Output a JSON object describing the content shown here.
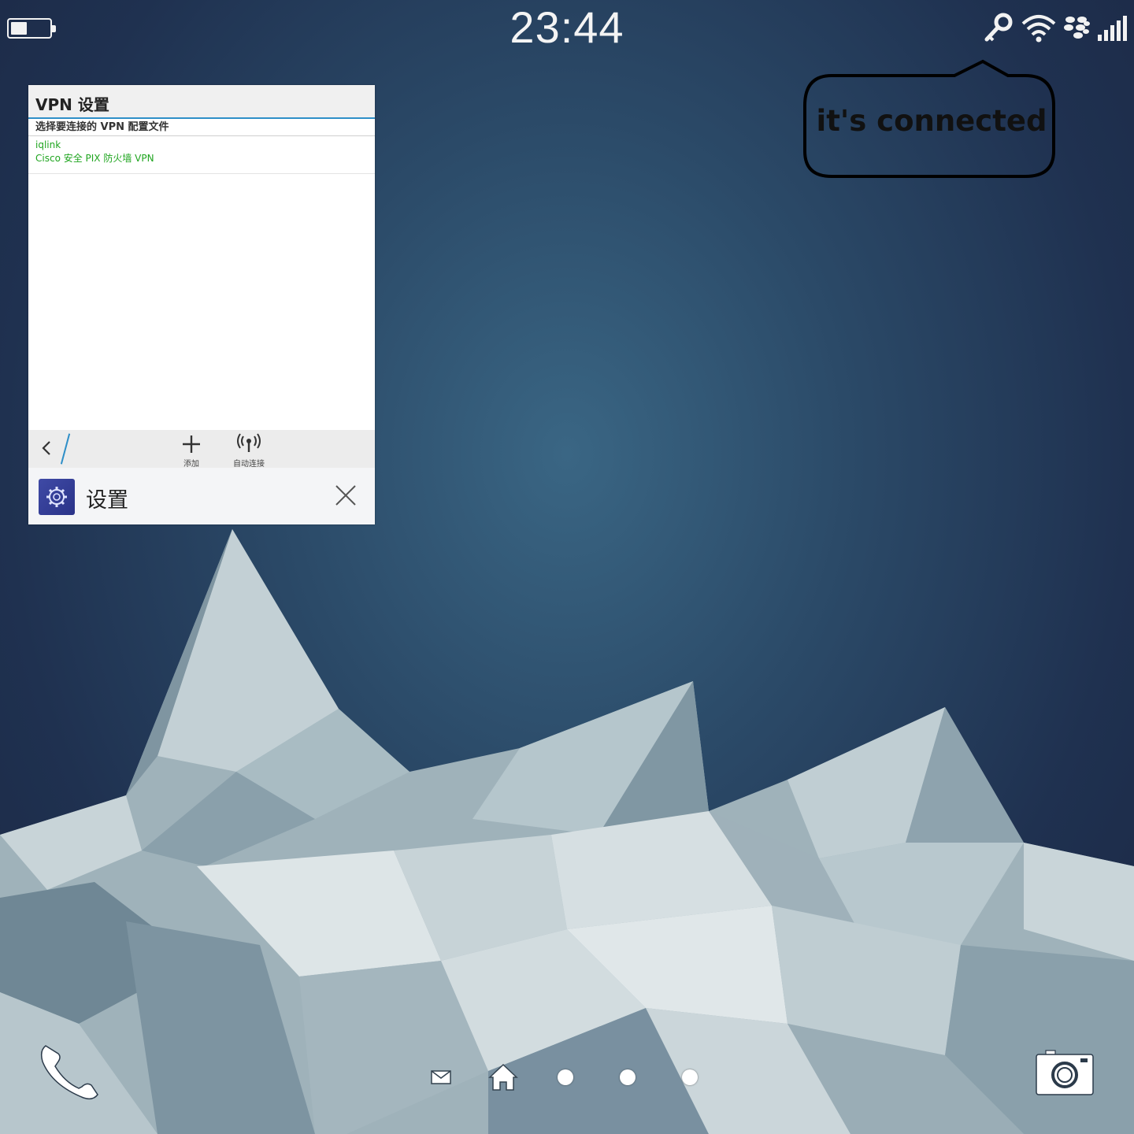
{
  "status_bar": {
    "time": "23:44",
    "battery_level": 0.38,
    "icons": [
      "battery-icon",
      "vpn-key-icon",
      "wifi-icon",
      "blackberry-icon",
      "cellular-signal-icon"
    ]
  },
  "annotation": {
    "text": "it's connected"
  },
  "app_card": {
    "title": "VPN 设置",
    "section_label": "选择要连接的 VPN 配置文件",
    "profiles": [
      {
        "name": "iqlink",
        "description": "Cisco 安全 PIX 防火墙 VPN",
        "status_color": "#1fa51f"
      }
    ],
    "actions": [
      {
        "label": "添加",
        "icon": "add-icon"
      },
      {
        "label": "自动连接",
        "icon": "auto-connect-icon"
      }
    ],
    "app_name": "设置",
    "accent_color": "#2f8fc8"
  },
  "dock": {
    "icons": [
      "phone-icon",
      "mail-icon",
      "home-icon",
      "page-dot",
      "page-dot",
      "page-dot",
      "camera-icon"
    ]
  }
}
